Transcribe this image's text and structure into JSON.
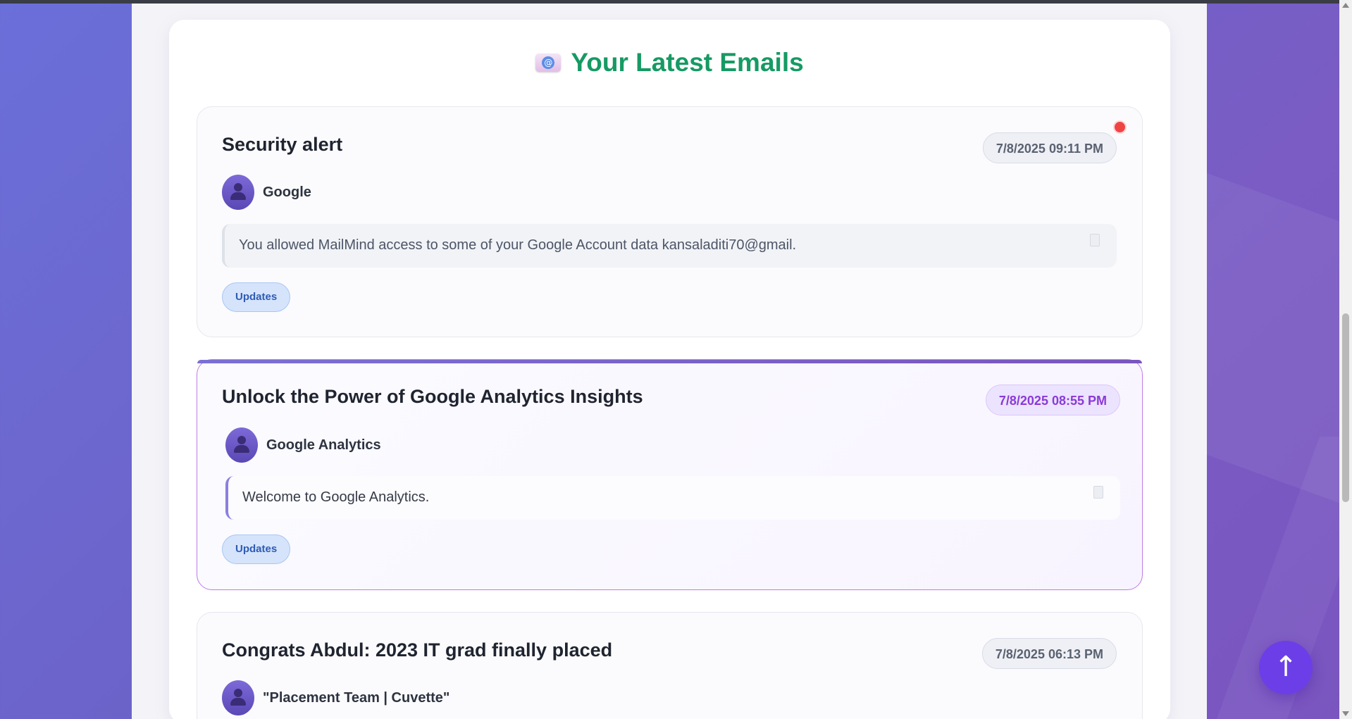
{
  "page": {
    "heading": "Your Latest Emails",
    "heading_icon": "email-icon"
  },
  "emails": [
    {
      "subject": "Security alert",
      "date": "7/8/2025 09:11 PM",
      "sender": "Google",
      "snippet": "You allowed MailMind access to some of your Google Account data kansaladiti70@gmail.",
      "tag": "Updates",
      "unread": true,
      "active": false
    },
    {
      "subject": "Unlock the Power of Google Analytics Insights",
      "date": "7/8/2025 08:55 PM",
      "sender": "Google Analytics",
      "snippet": "Welcome to Google Analytics.",
      "tag": "Updates",
      "unread": false,
      "active": true
    },
    {
      "subject": "Congrats Abdul: 2023 IT grad finally placed",
      "date": "7/8/2025 06:13 PM",
      "sender": "\"Placement Team | Cuvette\"",
      "active": false
    }
  ],
  "scroll_top_button": {
    "label": "↑"
  },
  "colors": {
    "heading": "#169a63",
    "accent": "#6c3ee8",
    "unread_dot": "#ef4444",
    "tag_bg": "#d5e4fb"
  }
}
